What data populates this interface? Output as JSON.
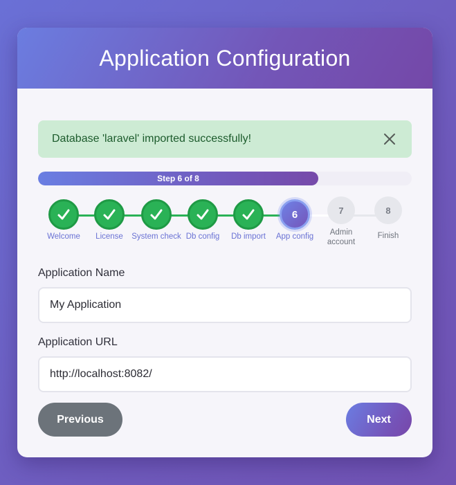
{
  "header": {
    "title": "Application Configuration"
  },
  "alert": {
    "message": "Database 'laravel' imported successfully!",
    "close_icon": "close-icon"
  },
  "progress": {
    "label": "Step 6 of 8",
    "current": 6,
    "total": 8,
    "fraction": 0.75
  },
  "steps": [
    {
      "number": "1",
      "label": "Welcome",
      "status": "done"
    },
    {
      "number": "2",
      "label": "License",
      "status": "done"
    },
    {
      "number": "3",
      "label": "System check",
      "status": "done"
    },
    {
      "number": "4",
      "label": "Db config",
      "status": "done"
    },
    {
      "number": "5",
      "label": "Db import",
      "status": "done"
    },
    {
      "number": "6",
      "label": "App config",
      "status": "current"
    },
    {
      "number": "7",
      "label": "Admin account",
      "status": "pending"
    },
    {
      "number": "8",
      "label": "Finish",
      "status": "pending"
    }
  ],
  "form": {
    "app_name": {
      "label": "Application Name",
      "value": "My Application"
    },
    "app_url": {
      "label": "Application URL",
      "value": "http://localhost:8082/"
    }
  },
  "buttons": {
    "previous": "Previous",
    "next": "Next"
  },
  "colors": {
    "accent": "#7355b8",
    "done": "#2ab256",
    "alert_bg": "#cdebd4",
    "secondary_button": "#6c737a"
  }
}
